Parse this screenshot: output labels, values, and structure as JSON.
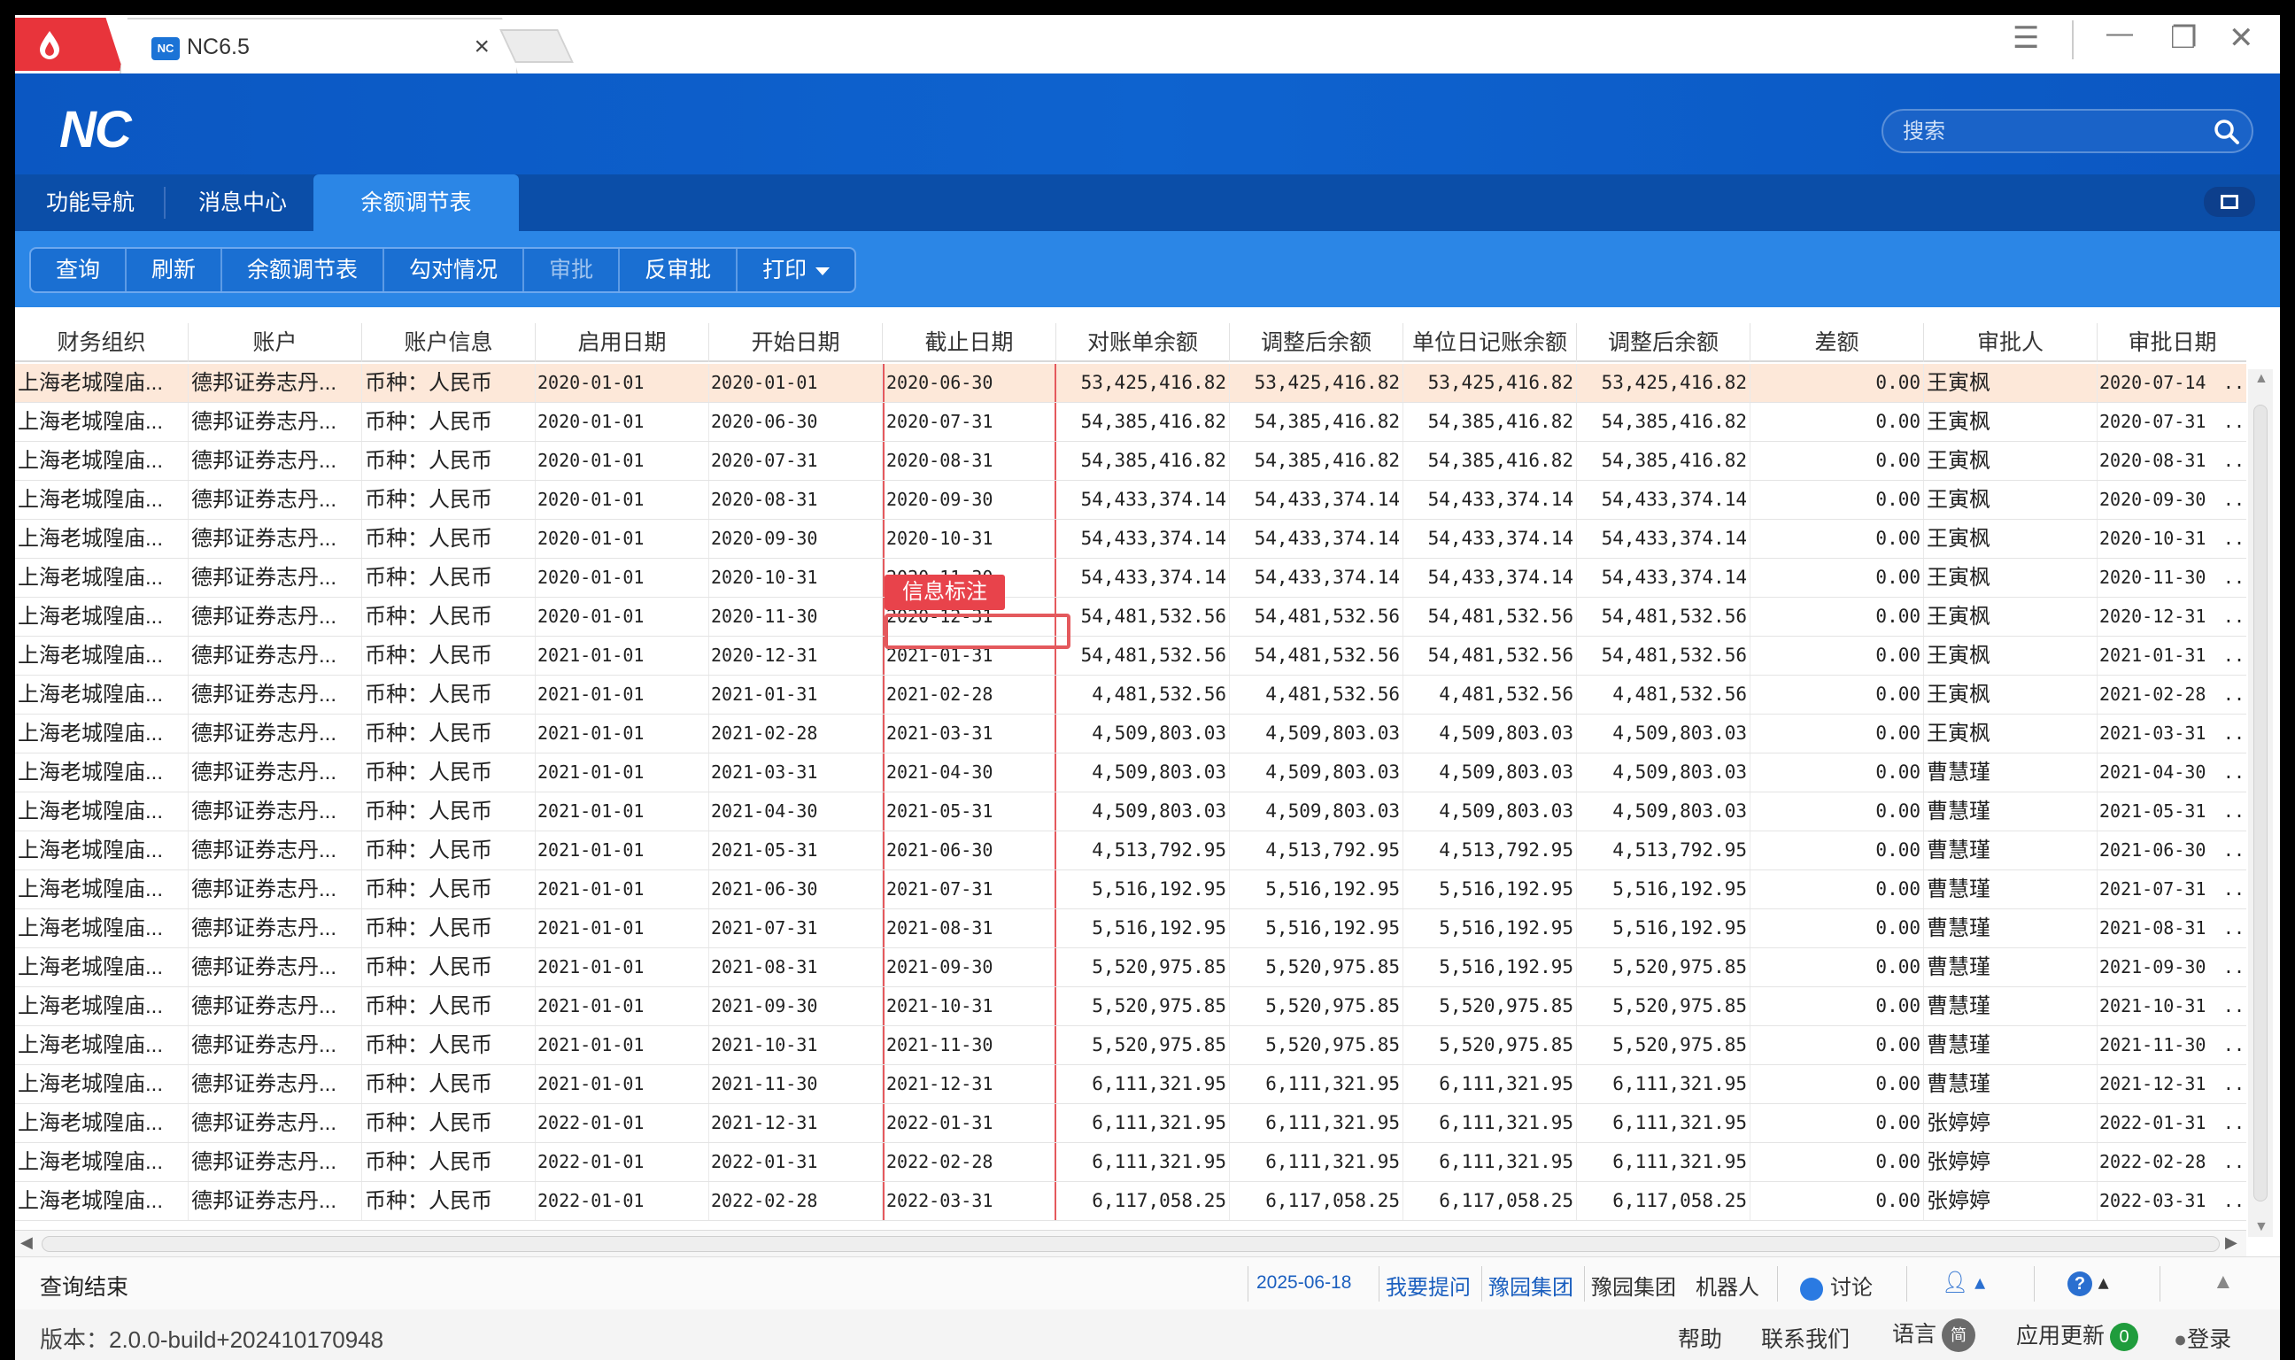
{
  "window": {
    "tab_title": "NC6.5",
    "tab_close": "×",
    "favicon_text": "NC",
    "controls": {
      "menu": "☰",
      "minimize": "—",
      "restore": "❐",
      "close": "✕"
    }
  },
  "header": {
    "logo": "NC",
    "search_placeholder": "搜索"
  },
  "nav": {
    "tabs": [
      {
        "label": "功能导航"
      },
      {
        "label": "消息中心"
      },
      {
        "label": "余额调节表"
      }
    ]
  },
  "toolbar": {
    "buttons": [
      {
        "label": "查询"
      },
      {
        "label": "刷新"
      },
      {
        "label": "余额调节表"
      },
      {
        "label": "勾对情况"
      },
      {
        "label": "审批"
      },
      {
        "label": "反审批"
      },
      {
        "label": "打印"
      }
    ]
  },
  "grid": {
    "columns": [
      "财务组织",
      "账户",
      "账户信息",
      "启用日期",
      "开始日期",
      "截止日期",
      "对账单余额",
      "调整后余额",
      "单位日记账余额",
      "调整后余额",
      "差额",
      "审批人",
      "审批日期"
    ],
    "org": "上海老城隍庙...",
    "account": "德邦证券志丹...",
    "account_info": "币种：人民币",
    "more": "..",
    "tooltip": "信息标注",
    "rows": [
      [
        "2020-01-01",
        "2020-01-01",
        "2020-06-30",
        "53,425,416.82",
        "53,425,416.82",
        "53,425,416.82",
        "53,425,416.82",
        "0.00",
        "王寅枫",
        "2020-07-14"
      ],
      [
        "2020-01-01",
        "2020-06-30",
        "2020-07-31",
        "54,385,416.82",
        "54,385,416.82",
        "54,385,416.82",
        "54,385,416.82",
        "0.00",
        "王寅枫",
        "2020-07-31"
      ],
      [
        "2020-01-01",
        "2020-07-31",
        "2020-08-31",
        "54,385,416.82",
        "54,385,416.82",
        "54,385,416.82",
        "54,385,416.82",
        "0.00",
        "王寅枫",
        "2020-08-31"
      ],
      [
        "2020-01-01",
        "2020-08-31",
        "2020-09-30",
        "54,433,374.14",
        "54,433,374.14",
        "54,433,374.14",
        "54,433,374.14",
        "0.00",
        "王寅枫",
        "2020-09-30"
      ],
      [
        "2020-01-01",
        "2020-09-30",
        "2020-10-31",
        "54,433,374.14",
        "54,433,374.14",
        "54,433,374.14",
        "54,433,374.14",
        "0.00",
        "王寅枫",
        "2020-10-31"
      ],
      [
        "2020-01-01",
        "2020-10-31",
        "2020-11-30",
        "54,433,374.14",
        "54,433,374.14",
        "54,433,374.14",
        "54,433,374.14",
        "0.00",
        "王寅枫",
        "2020-11-30"
      ],
      [
        "2020-01-01",
        "2020-11-30",
        "2020-12-31",
        "54,481,532.56",
        "54,481,532.56",
        "54,481,532.56",
        "54,481,532.56",
        "0.00",
        "王寅枫",
        "2020-12-31"
      ],
      [
        "2021-01-01",
        "2020-12-31",
        "2021-01-31",
        "54,481,532.56",
        "54,481,532.56",
        "54,481,532.56",
        "54,481,532.56",
        "0.00",
        "王寅枫",
        "2021-01-31"
      ],
      [
        "2021-01-01",
        "2021-01-31",
        "2021-02-28",
        "4,481,532.56",
        "4,481,532.56",
        "4,481,532.56",
        "4,481,532.56",
        "0.00",
        "王寅枫",
        "2021-02-28"
      ],
      [
        "2021-01-01",
        "2021-02-28",
        "2021-03-31",
        "4,509,803.03",
        "4,509,803.03",
        "4,509,803.03",
        "4,509,803.03",
        "0.00",
        "王寅枫",
        "2021-03-31"
      ],
      [
        "2021-01-01",
        "2021-03-31",
        "2021-04-30",
        "4,509,803.03",
        "4,509,803.03",
        "4,509,803.03",
        "4,509,803.03",
        "0.00",
        "曹慧瑾",
        "2021-04-30"
      ],
      [
        "2021-01-01",
        "2021-04-30",
        "2021-05-31",
        "4,509,803.03",
        "4,509,803.03",
        "4,509,803.03",
        "4,509,803.03",
        "0.00",
        "曹慧瑾",
        "2021-05-31"
      ],
      [
        "2021-01-01",
        "2021-05-31",
        "2021-06-30",
        "4,513,792.95",
        "4,513,792.95",
        "4,513,792.95",
        "4,513,792.95",
        "0.00",
        "曹慧瑾",
        "2021-06-30"
      ],
      [
        "2021-01-01",
        "2021-06-30",
        "2021-07-31",
        "5,516,192.95",
        "5,516,192.95",
        "5,516,192.95",
        "5,516,192.95",
        "0.00",
        "曹慧瑾",
        "2021-07-31"
      ],
      [
        "2021-01-01",
        "2021-07-31",
        "2021-08-31",
        "5,516,192.95",
        "5,516,192.95",
        "5,516,192.95",
        "5,516,192.95",
        "0.00",
        "曹慧瑾",
        "2021-08-31"
      ],
      [
        "2021-01-01",
        "2021-08-31",
        "2021-09-30",
        "5,520,975.85",
        "5,520,975.85",
        "5,516,192.95",
        "5,520,975.85",
        "0.00",
        "曹慧瑾",
        "2021-09-30"
      ],
      [
        "2021-01-01",
        "2021-09-30",
        "2021-10-31",
        "5,520,975.85",
        "5,520,975.85",
        "5,520,975.85",
        "5,520,975.85",
        "0.00",
        "曹慧瑾",
        "2021-10-31"
      ],
      [
        "2021-01-01",
        "2021-10-31",
        "2021-11-30",
        "5,520,975.85",
        "5,520,975.85",
        "5,520,975.85",
        "5,520,975.85",
        "0.00",
        "曹慧瑾",
        "2021-11-30"
      ],
      [
        "2021-01-01",
        "2021-11-30",
        "2021-12-31",
        "6,111,321.95",
        "6,111,321.95",
        "6,111,321.95",
        "6,111,321.95",
        "0.00",
        "曹慧瑾",
        "2021-12-31"
      ],
      [
        "2022-01-01",
        "2021-12-31",
        "2022-01-31",
        "6,111,321.95",
        "6,111,321.95",
        "6,111,321.95",
        "6,111,321.95",
        "0.00",
        "张婷婷",
        "2022-01-31"
      ],
      [
        "2022-01-01",
        "2022-01-31",
        "2022-02-28",
        "6,111,321.95",
        "6,111,321.95",
        "6,111,321.95",
        "6,111,321.95",
        "0.00",
        "张婷婷",
        "2022-02-28"
      ],
      [
        "2022-01-01",
        "2022-02-28",
        "2022-03-31",
        "6,117,058.25",
        "6,117,058.25",
        "6,117,058.25",
        "6,117,058.25",
        "0.00",
        "张婷婷",
        "2022-03-31"
      ]
    ]
  },
  "status": {
    "text": "查询结束",
    "date": "2025-06-18",
    "ask": "我要提问",
    "group1": "豫园集团",
    "group2": "豫园集团",
    "robot": "机器人",
    "discuss": "讨论"
  },
  "footer": {
    "version": "版本：2.0.0-build+202410170948",
    "help": "帮助",
    "contact": "联系我们",
    "language": "语言",
    "language_badge": "简",
    "update": "应用更新",
    "update_count": "0",
    "login": "登录"
  },
  "colors": {
    "header_blue": "#0b57c2",
    "toolbar_blue": "#2b86e6",
    "selected_row": "#fde8d9",
    "highlight_red": "#e4595d"
  }
}
